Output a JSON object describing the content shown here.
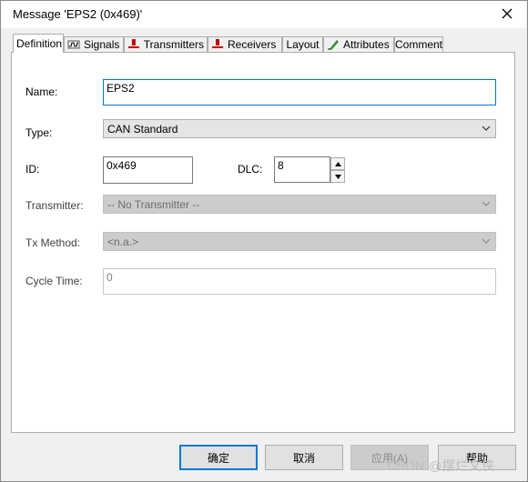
{
  "window": {
    "title": "Message 'EPS2 (0x469)'"
  },
  "tabs": [
    {
      "label": "Definition",
      "icon": ""
    },
    {
      "label": "Signals",
      "icon": "signal-wave-icon"
    },
    {
      "label": "Transmitters",
      "icon": "red-node-icon"
    },
    {
      "label": "Receivers",
      "icon": "red-node-icon"
    },
    {
      "label": "Layout",
      "icon": ""
    },
    {
      "label": "Attributes",
      "icon": "pen-icon"
    },
    {
      "label": "Comment",
      "icon": ""
    }
  ],
  "form": {
    "name_label": "Name:",
    "name_value": "EPS2",
    "type_label": "Type:",
    "type_value": "CAN Standard",
    "id_label": "ID:",
    "id_value": "0x469",
    "dlc_label": "DLC:",
    "dlc_value": "8",
    "transmitter_label": "Transmitter:",
    "transmitter_value": "-- No Transmitter --",
    "txmethod_label": "Tx Method:",
    "txmethod_value": "<n.a.>",
    "cycletime_label": "Cycle Time:",
    "cycletime_value": "0"
  },
  "buttons": {
    "ok": "确定",
    "cancel": "取消",
    "apply": "应用(A)",
    "help": "帮助"
  },
  "watermark": "CSDN @摆烂文侠",
  "colors": {
    "focus_border": "#0078d7",
    "red_node": "#c00000"
  }
}
